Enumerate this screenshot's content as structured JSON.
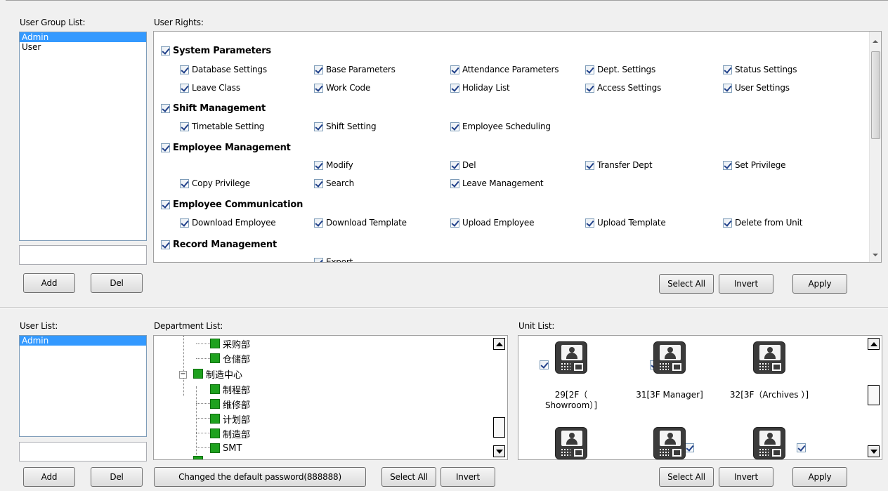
{
  "top": {
    "user_group_label": "User Group List:",
    "user_groups": [
      "Admin",
      "User"
    ],
    "user_rights_label": "User Rights:",
    "add_label": "Add",
    "del_label": "Del",
    "select_all_label": "Select All",
    "invert_label": "Invert",
    "apply_label": "Apply",
    "rights": {
      "system_parameters": "System Parameters",
      "database_settings": "Database Settings",
      "base_parameters": "Base Parameters",
      "attendance_parameters": "Attendance Parameters",
      "dept_settings": "Dept. Settings",
      "status_settings": "Status Settings",
      "leave_class": "Leave Class",
      "work_code": "Work Code",
      "holiday_list": "Holiday List",
      "access_settings": "Access Settings",
      "user_settings": "User Settings",
      "shift_management": "Shift Management",
      "timetable_setting": "Timetable Setting",
      "shift_setting": "Shift Setting",
      "employee_scheduling": "Employee Scheduling",
      "employee_management": "Employee Management",
      "modify": "Modify",
      "del": "Del",
      "transfer_dept": "Transfer Dept",
      "set_privilege": "Set Privilege",
      "copy_privilege": "Copy Privilege",
      "search": "Search",
      "leave_management": "Leave Management",
      "employee_communication": "Employee Communication",
      "download_employee": "Download Employee",
      "download_template": "Download Template",
      "upload_employee": "Upload Employee",
      "upload_template": "Upload Template",
      "delete_from_unit": "Delete from Unit",
      "record_management": "Record Management",
      "export": "Export"
    }
  },
  "bottom": {
    "user_list_label": "User List:",
    "users": [
      "Admin"
    ],
    "department_list_label": "Department List:",
    "departments": {
      "d1": "采购部",
      "d2": "仓储部",
      "d3": "制造中心",
      "d4": "制程部",
      "d5": "维修部",
      "d6": "计划部",
      "d7": "制造部",
      "d8": "SMT"
    },
    "unit_list_label": "Unit List:",
    "units": {
      "u1": "29[2F（ Showroom）]",
      "u2": "31[3F Manager]",
      "u3": "32[3F（Archives ）]"
    },
    "add_label": "Add",
    "del_label": "Del",
    "changed_password_label": "Changed the default password(888888)",
    "dept_select_all_label": "Select All",
    "dept_invert_label": "Invert",
    "select_all_label": "Select All",
    "invert_label": "Invert",
    "apply_label": "Apply"
  },
  "colors": {
    "selection": "#3399ff",
    "dept_icon": "#1ea11e",
    "device_icon": "#3b3b3b"
  }
}
